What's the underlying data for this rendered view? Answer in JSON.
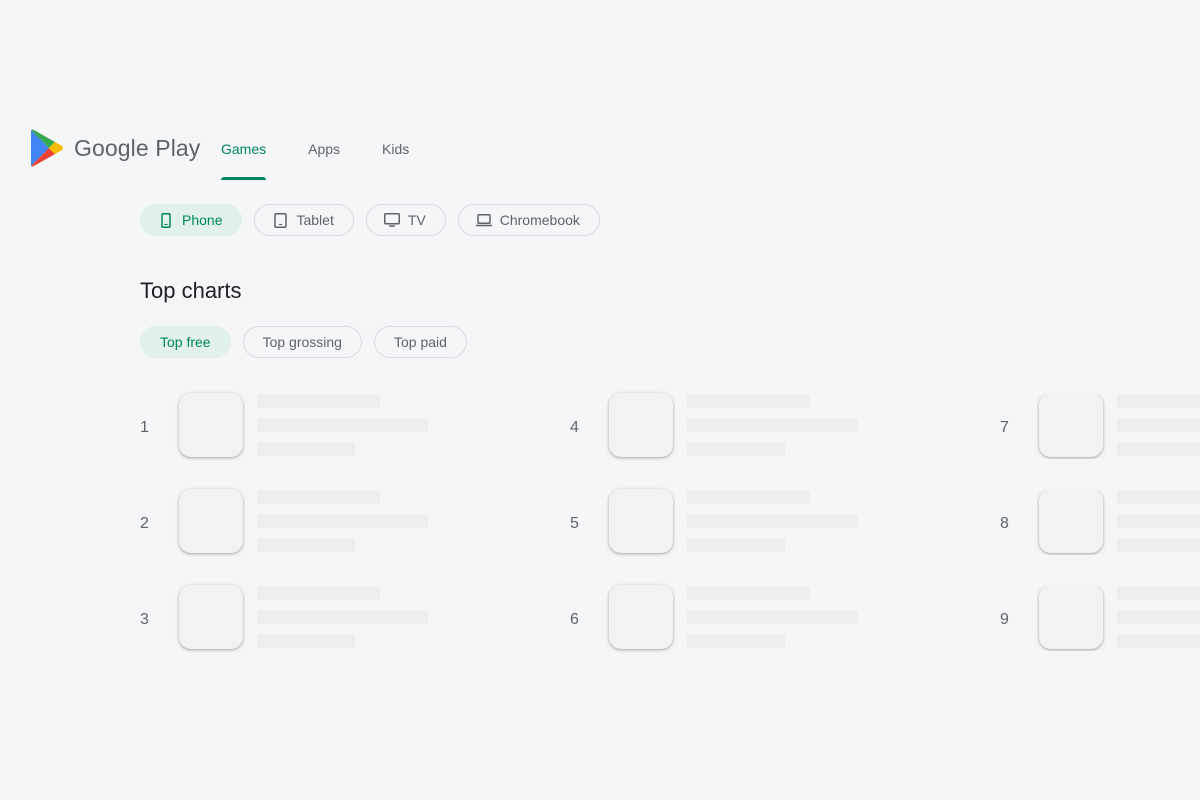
{
  "header": {
    "brand": "Google Play",
    "tabs": [
      {
        "label": "Games",
        "active": true
      },
      {
        "label": "Apps",
        "active": false
      },
      {
        "label": "Kids",
        "active": false
      }
    ]
  },
  "device_filters": [
    {
      "label": "Phone",
      "icon": "phone-icon",
      "selected": true
    },
    {
      "label": "Tablet",
      "icon": "tablet-icon",
      "selected": false
    },
    {
      "label": "TV",
      "icon": "tv-icon",
      "selected": false
    },
    {
      "label": "Chromebook",
      "icon": "laptop-icon",
      "selected": false
    }
  ],
  "section": {
    "title": "Top charts"
  },
  "chart_filters": [
    {
      "label": "Top free",
      "selected": true
    },
    {
      "label": "Top grossing",
      "selected": false
    },
    {
      "label": "Top paid",
      "selected": false
    }
  ],
  "chart_items": [
    {
      "rank": "1"
    },
    {
      "rank": "2"
    },
    {
      "rank": "3"
    },
    {
      "rank": "4"
    },
    {
      "rank": "5"
    },
    {
      "rank": "6"
    },
    {
      "rank": "7"
    },
    {
      "rank": "8"
    },
    {
      "rank": "9"
    }
  ],
  "colors": {
    "accent": "#01875f",
    "accent_bg": "#e2f1ec",
    "background": "#f5f6f7",
    "placeholder": "#eceeef"
  }
}
